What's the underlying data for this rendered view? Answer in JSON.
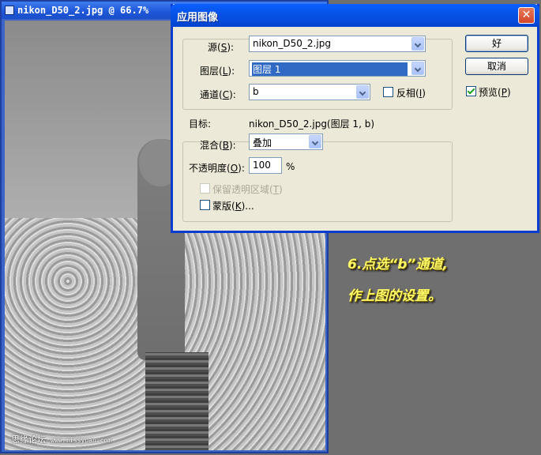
{
  "document": {
    "title": "nikon_D50_2.jpg @ 66.7%",
    "watermark_text": "思缘论坛",
    "watermark_url": "www.missyuan.com"
  },
  "dialog": {
    "title": "应用图像",
    "close_symbol": "✕",
    "source": {
      "label": "源",
      "hotkey": "S",
      "value": "nikon_D50_2.jpg"
    },
    "layer": {
      "label": "图层",
      "hotkey": "L",
      "value": "图层 1"
    },
    "channel": {
      "label": "通道",
      "hotkey": "C",
      "value": "b"
    },
    "invert": {
      "label": "反相",
      "hotkey": "I",
      "checked": false
    },
    "target": {
      "label": "目标:",
      "value": "nikon_D50_2.jpg(图层 1, b)"
    },
    "blending": {
      "label": "混合",
      "hotkey": "B",
      "value": "叠加"
    },
    "opacity": {
      "label": "不透明度",
      "hotkey": "O",
      "value": "100",
      "unit": "%"
    },
    "preserve_transparency": {
      "label": "保留透明区域",
      "hotkey": "T",
      "checked": false,
      "enabled": false
    },
    "mask": {
      "label": "蒙版",
      "hotkey": "K",
      "suffix": "...",
      "checked": false
    },
    "ok_label": "好",
    "cancel_label": "取消",
    "preview": {
      "label": "预览",
      "hotkey": "P",
      "checked": true
    }
  },
  "annotation": {
    "line1": "6.点选“b”通道,",
    "line2": "作上图的设置。",
    "color": "#fffa66"
  },
  "icons": [
    "photoshop-doc-icon",
    "close-icon",
    "chevron-down-icon",
    "checkbox-icon"
  ]
}
